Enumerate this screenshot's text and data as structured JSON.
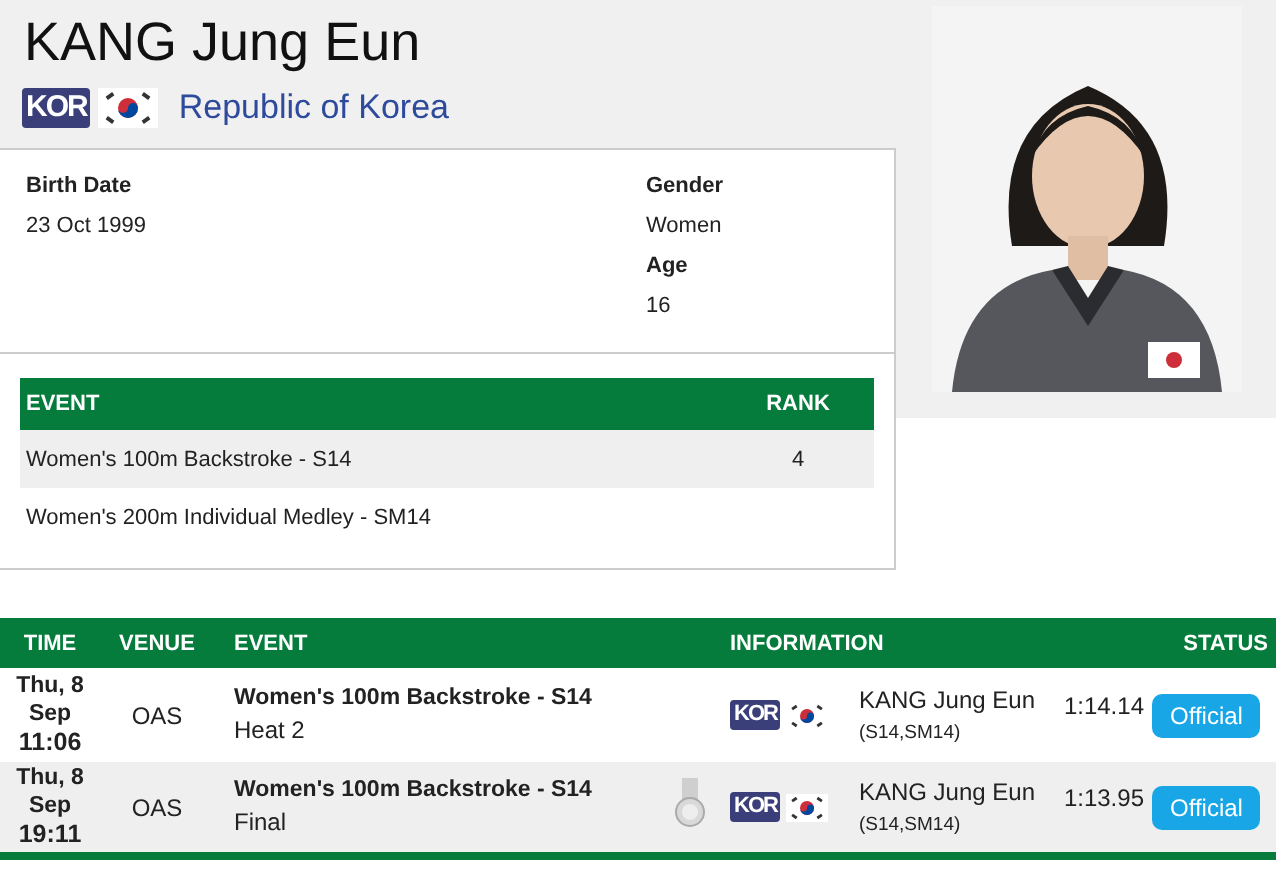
{
  "athlete": {
    "name": "KANG Jung Eun",
    "noc": "KOR",
    "country": "Republic of Korea"
  },
  "bio": {
    "left": [
      {
        "label": "Birth Date",
        "value": "23 Oct 1999"
      }
    ],
    "right": [
      {
        "label": "Gender",
        "value": "Women"
      },
      {
        "label": "Age",
        "value": "16"
      }
    ]
  },
  "events_table": {
    "columns": [
      "EVENT",
      "RANK"
    ],
    "rows": [
      {
        "event": "Women's 100m Backstroke - S14",
        "rank": "4"
      },
      {
        "event": "Women's 200m Individual Medley - SM14"
      }
    ]
  },
  "results": {
    "columns": [
      "TIME",
      "VENUE",
      "EVENT",
      "INFORMATION",
      "STATUS"
    ],
    "rows": [
      {
        "date": "Thu, 8 Sep",
        "time": "11:06",
        "venue": "OAS",
        "event": "Women's 100m Backstroke - S14",
        "phase": "Heat 2",
        "medal": false,
        "noc": "KOR",
        "athlete": "KANG Jung Eun",
        "classes": "(S14,SM14)",
        "result": "1:14.14",
        "status": "Official"
      },
      {
        "date": "Thu, 8 Sep",
        "time": "19:11",
        "venue": "OAS",
        "event": "Women's 100m Backstroke - S14",
        "phase": "Final",
        "medal": true,
        "noc": "KOR",
        "athlete": "KANG Jung Eun",
        "classes": "(S14,SM14)",
        "result": "1:13.95",
        "status": "Official"
      }
    ]
  }
}
